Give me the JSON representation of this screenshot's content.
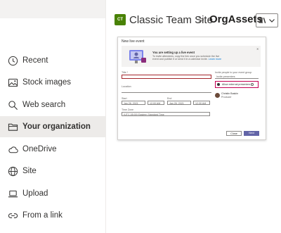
{
  "nav": {
    "items": [
      {
        "label": "Recent",
        "icon": "clock-icon"
      },
      {
        "label": "Stock images",
        "icon": "image-icon"
      },
      {
        "label": "Web search",
        "icon": "search-icon"
      },
      {
        "label": "Your organization",
        "icon": "folder-icon",
        "selected": true
      },
      {
        "label": "OneDrive",
        "icon": "cloud-icon"
      },
      {
        "label": "Site",
        "icon": "globe-icon"
      },
      {
        "label": "Upload",
        "icon": "laptop-icon"
      },
      {
        "label": "From a link",
        "icon": "link-icon"
      }
    ]
  },
  "header": {
    "logo_text": "CT",
    "site_name": "Classic Team Site",
    "separator": ">",
    "library_name": "OrgAssets"
  },
  "preview": {
    "dialog_title": "New live event",
    "info_heading": "You are setting up a live event",
    "info_body": "To invite attendees, copy the link once you schedule the live event and publish it or send it in a calendar invite.",
    "info_link": "Learn more",
    "title_label": "Title *",
    "location_label": "Location",
    "start_label": "Start",
    "end_label": "End",
    "start_date": "Jan 26, 2021",
    "start_time": "12:00 AM",
    "end_date": "Jan 26, 2021",
    "end_time": "12:30 AM",
    "timezone_label": "Time Zone",
    "timezone_value": "(UTC-05:00) Eastern Standard Time",
    "invite_label": "Invite people to your event group",
    "invite_placeholder": "Invite presenters",
    "external_label": "Allow external presenters",
    "person_name": "Christin Baskin",
    "person_role": "Producer",
    "close_label": "Close",
    "next_label": "Next"
  },
  "colors": {
    "accent": "#6264a7",
    "highlight": "#c30052",
    "site_logo": "#498205"
  }
}
